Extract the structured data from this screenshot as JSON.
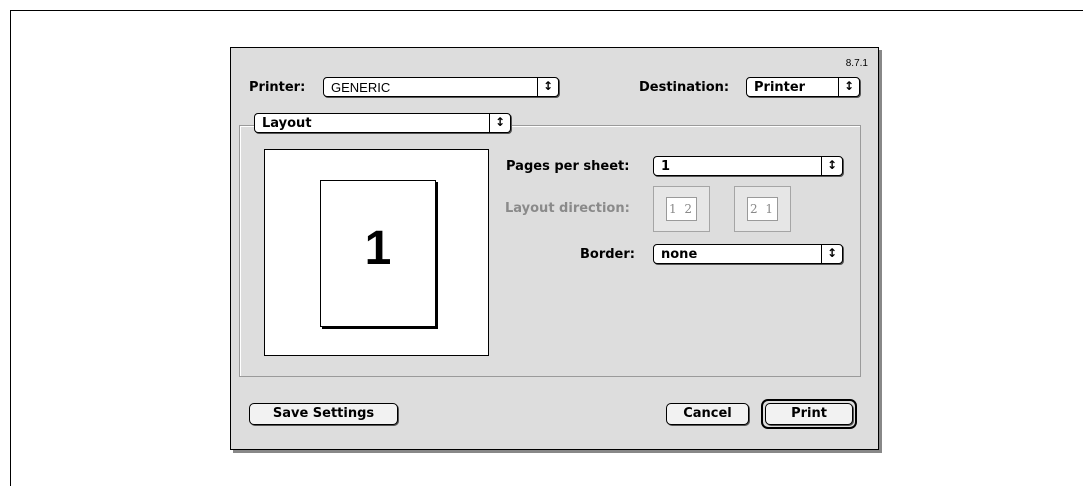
{
  "dialog": {
    "version": "8.7.1",
    "printer": {
      "label": "Printer:",
      "value": "GENERIC"
    },
    "destination": {
      "label": "Destination:",
      "value": "Printer"
    },
    "panel_selector": {
      "value": "Layout"
    },
    "preview": {
      "page_number": "1"
    },
    "pages_per_sheet": {
      "label": "Pages per sheet:",
      "value": "1"
    },
    "layout_direction": {
      "label": "Layout direction:",
      "option_ltr": "1 2",
      "option_rtl": "2 1"
    },
    "border": {
      "label": "Border:",
      "value": "none"
    },
    "buttons": {
      "save": "Save Settings",
      "cancel": "Cancel",
      "print": "Print"
    },
    "icons": {
      "popup_arrow": "updown-arrows-icon"
    }
  }
}
